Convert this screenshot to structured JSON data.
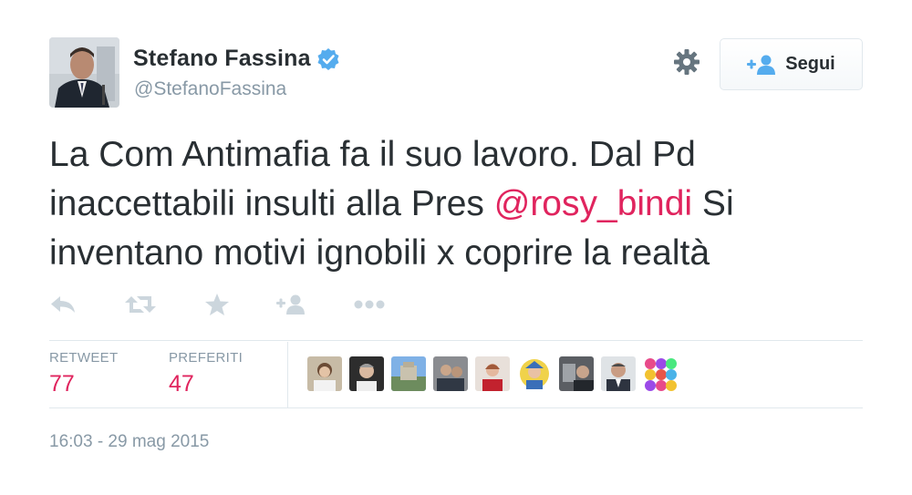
{
  "user": {
    "fullname": "Stefano Fassina",
    "username": "@StefanoFassina",
    "verified": true
  },
  "follow_button": {
    "label": "Segui",
    "icon": "follow-person-plus-icon"
  },
  "settings": {
    "icon": "gear-icon"
  },
  "tweet": {
    "text_before": "La Com Antimafia fa il suo lavoro. Dal Pd inaccettabili insulti alla Pres ",
    "mention": "@rosy_bindi",
    "text_after": " Si inventano motivi ignobili x coprire la realtà"
  },
  "actions": [
    {
      "name": "reply",
      "icon": "reply-icon"
    },
    {
      "name": "retweet",
      "icon": "retweet-icon"
    },
    {
      "name": "favorite",
      "icon": "star-icon"
    },
    {
      "name": "follow",
      "icon": "follow-person-plus-icon"
    },
    {
      "name": "more",
      "icon": "more-dots-icon"
    }
  ],
  "stats": {
    "retweet_label": "RETWEET",
    "retweet_count": "77",
    "favorites_label": "PREFERITI",
    "favorites_count": "47"
  },
  "timestamp": "16:03 - 29 mag 2015",
  "colors": {
    "accent": "#e0245e",
    "muted": "#8899a6",
    "verified": "#55acee",
    "text": "#292f33",
    "border": "#e1e8ed"
  }
}
